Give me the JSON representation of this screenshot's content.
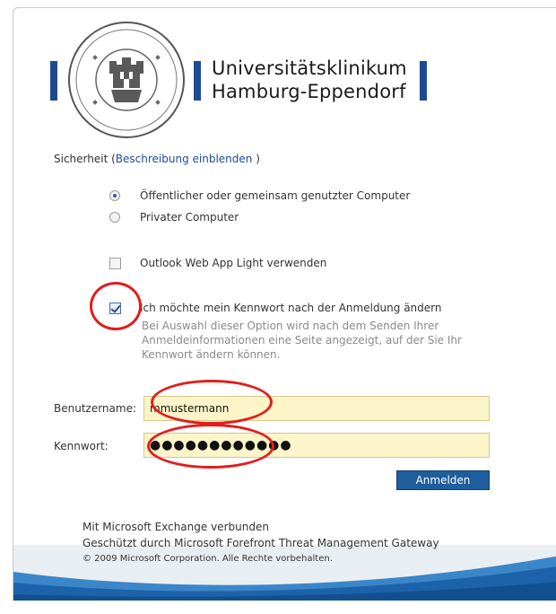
{
  "brand": {
    "line1": "Universitätsklinikum",
    "line2": "Hamburg-Eppendorf"
  },
  "security": {
    "label_before": "Sicherheit (",
    "link": "Beschreibung einblenden",
    "label_after": " )"
  },
  "options": {
    "public_computer": "Öffentlicher oder gemeinsam genutzter Computer",
    "private_computer": "Privater Computer",
    "light_version": "Outlook Web App Light verwenden",
    "change_password": "Ich möchte mein Kennwort nach der Anmeldung ändern",
    "change_password_hint": "Bei Auswahl dieser Option wird nach dem Senden Ihrer Anmeldeinformationen eine Seite angezeigt, auf der Sie Ihr Kennwort ändern können."
  },
  "form": {
    "username_label": "Benutzername:",
    "username_value": "mmustermann",
    "password_label": "Kennwort:",
    "password_value": "●●●●●●●●●●●●",
    "submit_label": "Anmelden"
  },
  "footer": {
    "line1": "Mit Microsoft Exchange verbunden",
    "line2": "Geschützt durch Microsoft Forefront Threat Management Gateway",
    "line3": "© 2009 Microsoft Corporation. Alle Rechte vorbehalten."
  },
  "colors": {
    "brand_blue": "#1e4a92",
    "button": "#1f5e9c",
    "highlight": "#e21d1d",
    "field_bg": "#fbf5c9"
  }
}
